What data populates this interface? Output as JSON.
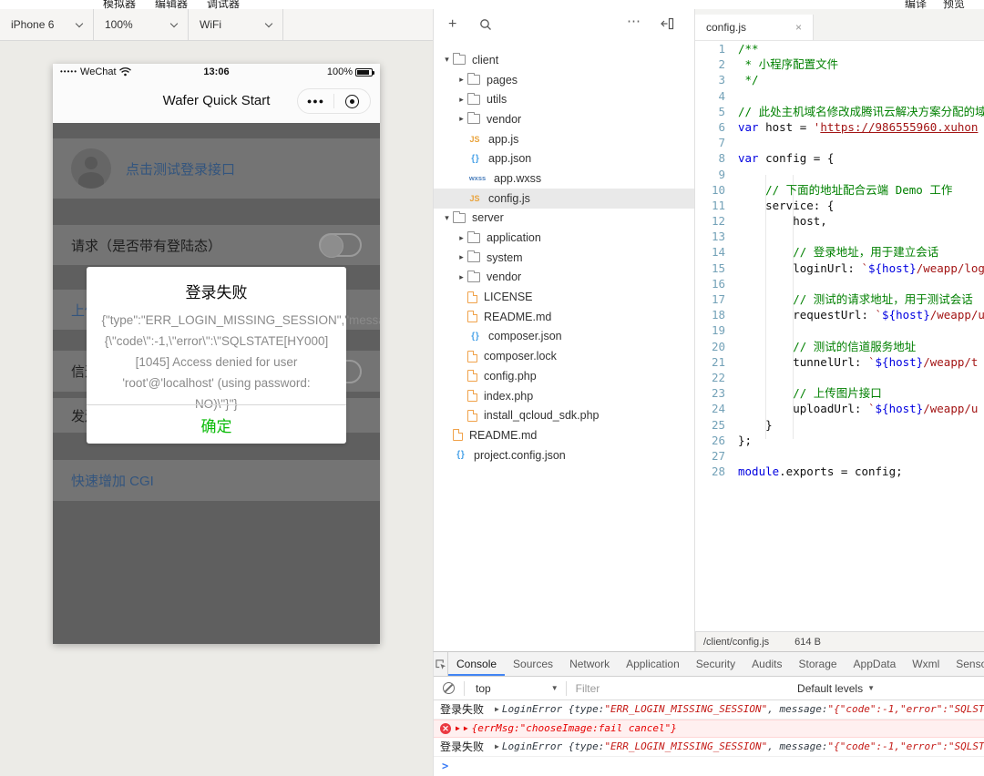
{
  "colors": {
    "accent_blue": "#4285f4",
    "dialog_ok_green": "#09bb07",
    "error_red": "#e60000",
    "string_red": "#a31515",
    "comment_green": "#008000",
    "keyword_blue": "#0000e0",
    "dimmed_link_blue": "#33557e"
  },
  "menu": {
    "tabs": [
      "模拟器",
      "编辑器",
      "调试器"
    ],
    "right": [
      "编译",
      "预览"
    ]
  },
  "sim_toolbar": {
    "device": "iPhone 6",
    "zoom": "100%",
    "network": "WiFi"
  },
  "phone": {
    "status": {
      "carrier": "WeChat",
      "signal_dots": "•••••",
      "time": "13:06",
      "battery": "100%"
    },
    "nav_title": "Wafer Quick Start",
    "rows": {
      "user_label": "点击测试登录接口",
      "request_label": "请求（是否带有登陆态）",
      "upload_label": "上传图片",
      "channel_label": "信道",
      "send_label": "发送消息",
      "cgi_label": "快速增加 CGI"
    },
    "dialog": {
      "title": "登录失败",
      "body": "{\"type\":\"ERR_LOGIN_MISSING_SESSION\",\"message\":\"{\\\"code\\\":-1,\\\"error\\\":\\\"SQLSTATE[HY000] [1045] Access denied for user 'root'@'localhost' (using password: NO)\\\"}\"}",
      "ok_label": "确定"
    }
  },
  "explorer": {
    "items": [
      {
        "label": "client",
        "icon": "folder-open",
        "arrow": "down",
        "level": 0
      },
      {
        "label": "pages",
        "icon": "folder",
        "arrow": "right",
        "level": 1
      },
      {
        "label": "utils",
        "icon": "folder",
        "arrow": "right",
        "level": 1
      },
      {
        "label": "vendor",
        "icon": "folder",
        "arrow": "right",
        "level": 1
      },
      {
        "label": "app.js",
        "icon": "js",
        "arrow": null,
        "level": 1
      },
      {
        "label": "app.json",
        "icon": "json",
        "arrow": null,
        "level": 1
      },
      {
        "label": "app.wxss",
        "icon": "wxss",
        "arrow": null,
        "level": 1
      },
      {
        "label": "config.js",
        "icon": "js",
        "arrow": null,
        "level": 1,
        "selected": true
      },
      {
        "label": "server",
        "icon": "folder-open",
        "arrow": "down",
        "level": 0
      },
      {
        "label": "application",
        "icon": "folder",
        "arrow": "right",
        "level": 1
      },
      {
        "label": "system",
        "icon": "folder",
        "arrow": "right",
        "level": 1
      },
      {
        "label": "vendor",
        "icon": "folder",
        "arrow": "right",
        "level": 1
      },
      {
        "label": "LICENSE",
        "icon": "file",
        "arrow": null,
        "level": 1
      },
      {
        "label": "README.md",
        "icon": "file",
        "arrow": null,
        "level": 1
      },
      {
        "label": "composer.json",
        "icon": "json",
        "arrow": null,
        "level": 1
      },
      {
        "label": "composer.lock",
        "icon": "file",
        "arrow": null,
        "level": 1
      },
      {
        "label": "config.php",
        "icon": "file",
        "arrow": null,
        "level": 1
      },
      {
        "label": "index.php",
        "icon": "file",
        "arrow": null,
        "level": 1
      },
      {
        "label": "install_qcloud_sdk.php",
        "icon": "file",
        "arrow": null,
        "level": 1
      },
      {
        "label": "README.md",
        "icon": "file",
        "arrow": null,
        "level": 0
      },
      {
        "label": "project.config.json",
        "icon": "json",
        "arrow": null,
        "level": 0
      }
    ]
  },
  "editor": {
    "tab_label": "config.js",
    "close_label": "×",
    "status_path": "/client/config.js",
    "status_size": "614 B",
    "lines": [
      {
        "n": 1,
        "tokens": [
          {
            "t": "/**",
            "c": "com"
          }
        ]
      },
      {
        "n": 2,
        "tokens": [
          {
            "t": " * 小程序配置文件",
            "c": "com"
          }
        ]
      },
      {
        "n": 3,
        "tokens": [
          {
            "t": " */",
            "c": "com"
          }
        ]
      },
      {
        "n": 4,
        "tokens": []
      },
      {
        "n": 5,
        "tokens": [
          {
            "t": "// 此处主机域名修改成腾讯云解决方案分配的域名",
            "c": "com"
          }
        ]
      },
      {
        "n": 6,
        "tokens": [
          {
            "t": "var",
            "c": "kw"
          },
          {
            "t": " host = ",
            "c": "pln"
          },
          {
            "t": "'",
            "c": "str"
          },
          {
            "t": "https://986555960.xuhon",
            "c": "link"
          }
        ]
      },
      {
        "n": 7,
        "tokens": []
      },
      {
        "n": 8,
        "tokens": [
          {
            "t": "var",
            "c": "kw"
          },
          {
            "t": " config = {",
            "c": "pln"
          }
        ]
      },
      {
        "n": 9,
        "tokens": []
      },
      {
        "n": 10,
        "tokens": [
          {
            "t": "    // 下面的地址配合云端 Demo 工作",
            "c": "com"
          }
        ]
      },
      {
        "n": 11,
        "tokens": [
          {
            "t": "    service: {",
            "c": "pln"
          }
        ]
      },
      {
        "n": 12,
        "tokens": [
          {
            "t": "        host,",
            "c": "pln"
          }
        ]
      },
      {
        "n": 13,
        "tokens": []
      },
      {
        "n": 14,
        "tokens": [
          {
            "t": "        // 登录地址，用于建立会话",
            "c": "com"
          }
        ]
      },
      {
        "n": 15,
        "tokens": [
          {
            "t": "        loginUrl: ",
            "c": "pln"
          },
          {
            "t": "`",
            "c": "str"
          },
          {
            "t": "${host}",
            "c": "kw"
          },
          {
            "t": "/weapp/login",
            "c": "str"
          }
        ]
      },
      {
        "n": 16,
        "tokens": []
      },
      {
        "n": 17,
        "tokens": [
          {
            "t": "        // 测试的请求地址，用于测试会话",
            "c": "com"
          }
        ]
      },
      {
        "n": 18,
        "tokens": [
          {
            "t": "        requestUrl: ",
            "c": "pln"
          },
          {
            "t": "`",
            "c": "str"
          },
          {
            "t": "${host}",
            "c": "kw"
          },
          {
            "t": "/weapp/user",
            "c": "str"
          }
        ]
      },
      {
        "n": 19,
        "tokens": []
      },
      {
        "n": 20,
        "tokens": [
          {
            "t": "        // 测试的信道服务地址",
            "c": "com"
          }
        ]
      },
      {
        "n": 21,
        "tokens": [
          {
            "t": "        tunnelUrl: ",
            "c": "pln"
          },
          {
            "t": "`",
            "c": "str"
          },
          {
            "t": "${host}",
            "c": "kw"
          },
          {
            "t": "/weapp/t",
            "c": "str"
          }
        ]
      },
      {
        "n": 22,
        "tokens": []
      },
      {
        "n": 23,
        "tokens": [
          {
            "t": "        // 上传图片接口",
            "c": "com"
          }
        ]
      },
      {
        "n": 24,
        "tokens": [
          {
            "t": "        uploadUrl: ",
            "c": "pln"
          },
          {
            "t": "`",
            "c": "str"
          },
          {
            "t": "${host}",
            "c": "kw"
          },
          {
            "t": "/weapp/u",
            "c": "str"
          }
        ]
      },
      {
        "n": 25,
        "tokens": [
          {
            "t": "    }",
            "c": "pln"
          }
        ]
      },
      {
        "n": 26,
        "tokens": [
          {
            "t": "};",
            "c": "pln"
          }
        ]
      },
      {
        "n": 27,
        "tokens": []
      },
      {
        "n": 28,
        "tokens": [
          {
            "t": "module",
            "c": "kw"
          },
          {
            "t": ".exports = config;",
            "c": "pln"
          }
        ]
      }
    ]
  },
  "devtools": {
    "tabs": [
      "Console",
      "Sources",
      "Network",
      "Application",
      "Security",
      "Audits",
      "Storage",
      "AppData",
      "Wxml",
      "Sensor"
    ],
    "active_tab": "Console",
    "context": "top",
    "filter_placeholder": "Filter",
    "levels_label": "Default levels",
    "prompt_chevron": ">",
    "messages": [
      {
        "kind": "log",
        "segments": [
          {
            "t": "登录失败",
            "c": "plain"
          },
          {
            "t": "▶",
            "c": "tri"
          },
          {
            "t": "LoginError {type: ",
            "c": "obj"
          },
          {
            "t": "\"ERR_LOGIN_MISSING_SESSION\"",
            "c": "str"
          },
          {
            "t": ", message: ",
            "c": "obj"
          },
          {
            "t": "\"{\"code\":-1,\"error\":\"SQLSTA",
            "c": "str"
          }
        ]
      },
      {
        "kind": "error",
        "segments": [
          {
            "t": "▶",
            "c": "etri"
          },
          {
            "t": "▶",
            "c": "etri"
          },
          {
            "t": "{errMsg: ",
            "c": "err"
          },
          {
            "t": "\"chooseImage:fail cancel\"",
            "c": "errstr"
          },
          {
            "t": "}",
            "c": "err"
          }
        ]
      },
      {
        "kind": "log",
        "segments": [
          {
            "t": "登录失败",
            "c": "plain"
          },
          {
            "t": "▶",
            "c": "tri"
          },
          {
            "t": "LoginError {type: ",
            "c": "obj"
          },
          {
            "t": "\"ERR_LOGIN_MISSING_SESSION\"",
            "c": "str"
          },
          {
            "t": ", message: ",
            "c": "obj"
          },
          {
            "t": "\"{\"code\":-1,\"error\":\"SQLSTA",
            "c": "str"
          }
        ]
      }
    ]
  }
}
